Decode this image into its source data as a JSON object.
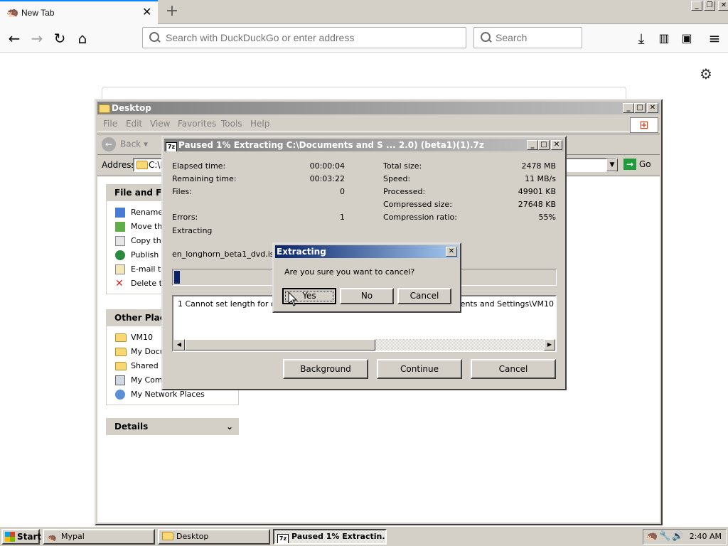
{
  "browser": {
    "tab_title": "New Tab",
    "tab_close": "✕",
    "new_tab": "+",
    "url_placeholder": "Search with DuckDuckGo or enter address",
    "search_placeholder": "Search"
  },
  "explorer": {
    "title": "Desktop",
    "menu": [
      "File",
      "Edit",
      "View",
      "Favorites",
      "Tools",
      "Help"
    ],
    "back_label": "Back",
    "address_label": "Address",
    "address_value": "C:\\D",
    "go_label": "Go",
    "file_tasks": {
      "title": "File and Fold",
      "items": [
        "Rename",
        "Move this",
        "Copy this",
        "Publish th",
        "E-mail thi",
        "Delete th"
      ]
    },
    "other_places": {
      "title": "Other Place",
      "items": [
        "VM10",
        "My Docu",
        "Shared D",
        "My Comp",
        "My Network Places"
      ]
    },
    "details": {
      "title": "Details"
    }
  },
  "zip": {
    "title": "Paused 1% Extracting C:\\Documents and S ... 2.0) (beta1)(1).7z",
    "left_stats": [
      {
        "label": "Elapsed time:",
        "value": "00:00:04"
      },
      {
        "label": "Remaining time:",
        "value": "00:03:22"
      },
      {
        "label": "Files:",
        "value": "0"
      },
      {
        "label": "",
        "value": ""
      },
      {
        "label": "Errors:",
        "value": "1"
      }
    ],
    "right_stats": [
      {
        "label": "Total size:",
        "value": "2478 MB"
      },
      {
        "label": "Speed:",
        "value": "11 MB/s"
      },
      {
        "label": "Processed:",
        "value": "49901 KB"
      },
      {
        "label": "Compressed size:",
        "value": "27648 KB"
      },
      {
        "label": "Compression ratio:",
        "value": "55%"
      }
    ],
    "status": "Extracting",
    "filename": "en_longhorn_beta1_dvd.iso",
    "progress": 0.01,
    "error_row": "1    Cannot set length for out",
    "error_tail": "ocuments and Settings\\VM10",
    "buttons": {
      "background": "Background",
      "continue": "Continue",
      "cancel": "Cancel"
    }
  },
  "confirm": {
    "title": "Extracting",
    "message": "Are you sure you want to cancel?",
    "yes": "Yes",
    "no": "No",
    "cancel": "Cancel"
  },
  "taskbar": {
    "start": "Start",
    "items": [
      "Mypal",
      "Desktop",
      "Paused 1% Extractin..."
    ],
    "clock": "2:40 AM"
  }
}
